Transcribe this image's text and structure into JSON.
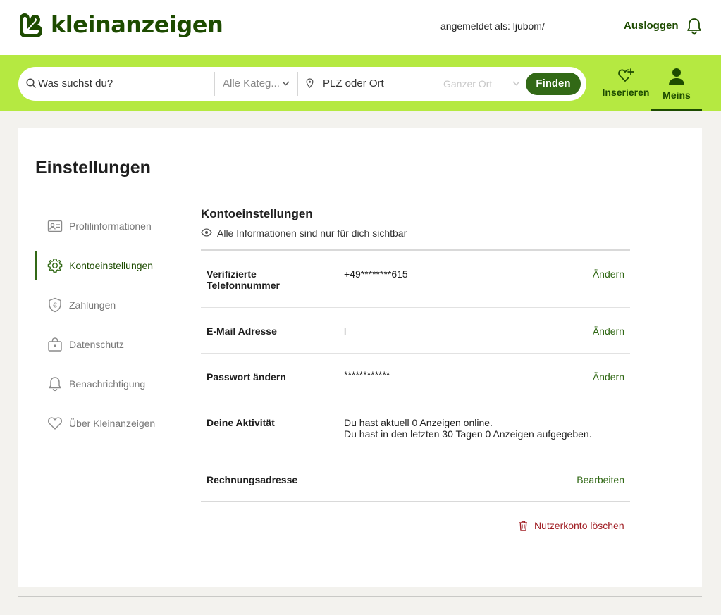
{
  "header": {
    "brand": "kleinanzeigen",
    "logged_in_as": "angemeldet als: ljubom/",
    "logout": "Ausloggen"
  },
  "search": {
    "query_placeholder": "Was suchst du?",
    "category": "Alle Kateg...",
    "location_placeholder": "PLZ oder Ort",
    "radius": "Ganzer Ort",
    "find_button": "Finden"
  },
  "nav": {
    "post_ad": "Inserieren",
    "mine": "Meins"
  },
  "page": {
    "title": "Einstellungen"
  },
  "sidebar": {
    "items": [
      {
        "label": "Profilinformationen",
        "icon": "id-card-icon"
      },
      {
        "label": "Kontoeinstellungen",
        "icon": "gear-icon",
        "active": true
      },
      {
        "label": "Zahlungen",
        "icon": "euro-shield-icon"
      },
      {
        "label": "Datenschutz",
        "icon": "lock-bag-icon"
      },
      {
        "label": "Benachrichtigung",
        "icon": "bell-icon"
      },
      {
        "label": "Über Kleinanzeigen",
        "icon": "heart-icon"
      }
    ]
  },
  "settings": {
    "title": "Kontoeinstellungen",
    "subtitle": "Alle Informationen sind nur für dich sichtbar",
    "rows": [
      {
        "label_line1": "Verifizierte",
        "label_line2": "Telefonnummer",
        "value": "+49********615",
        "action": "Ändern"
      },
      {
        "label": "E-Mail Adresse",
        "value": "l",
        "action": "Ändern"
      },
      {
        "label": "Passwort ändern",
        "value": "************",
        "action": "Ändern"
      },
      {
        "label": "Deine Aktivität",
        "value_line1": "Du hast aktuell 0 Anzeigen online.",
        "value_line2": "Du hast in den letzten 30 Tagen 0 Anzeigen aufgegeben."
      },
      {
        "label": "Rechnungsadresse",
        "action": "Bearbeiten"
      }
    ],
    "delete_account": "Nutzerkonto löschen"
  },
  "colors": {
    "brand_dark": "#1d4b00",
    "brand_lime": "#b5e941",
    "button_green": "#326916",
    "danger": "#a01e24"
  }
}
